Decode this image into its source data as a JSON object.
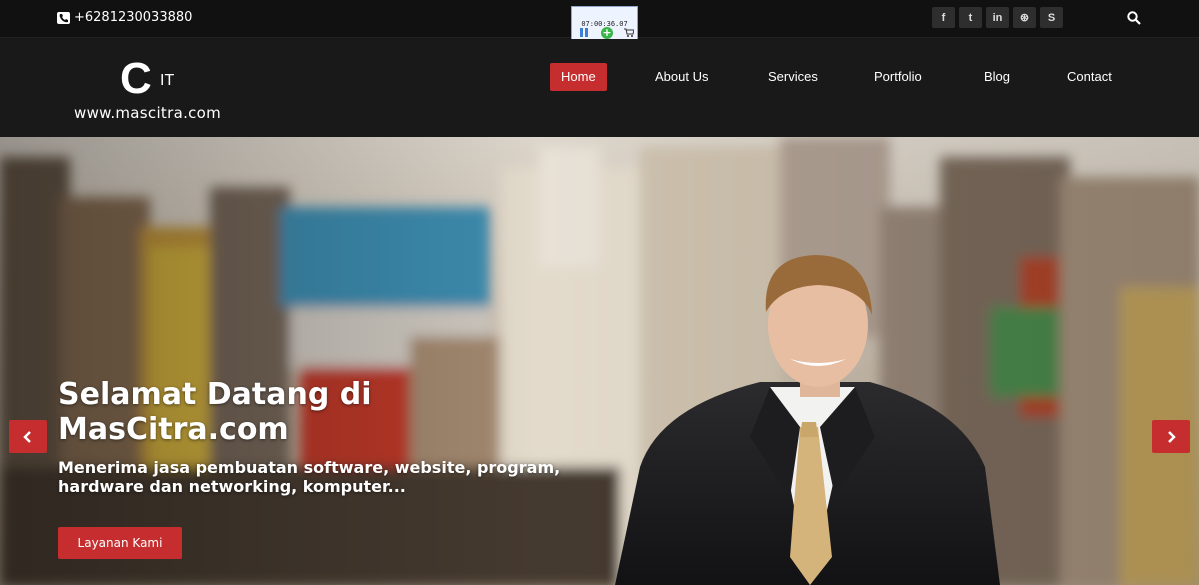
{
  "topbar": {
    "phone": "+6281230033880",
    "widget_time": "07:00:36.07",
    "social_icons": [
      {
        "name": "facebook-icon",
        "glyph": "f"
      },
      {
        "name": "twitter-icon",
        "glyph": "t"
      },
      {
        "name": "linkedin-icon",
        "glyph": "in"
      },
      {
        "name": "dribbble-icon",
        "glyph": "⊛"
      },
      {
        "name": "skype-icon",
        "glyph": "S"
      }
    ]
  },
  "logo": {
    "letter": "C",
    "suffix": "IT",
    "url": "www.mascitra.com"
  },
  "nav": {
    "items": [
      {
        "label": "Home",
        "active": true
      },
      {
        "label": "About Us",
        "active": false
      },
      {
        "label": "Services",
        "active": false
      },
      {
        "label": "Portfolio",
        "active": false
      },
      {
        "label": "Blog",
        "active": false
      },
      {
        "label": "Contact",
        "active": false
      }
    ]
  },
  "hero": {
    "title": "Selamat Datang di MasCitra.com",
    "subtitle": "Menerima jasa pembuatan software, website, program, hardware dan networking, komputer...",
    "cta": "Layanan Kami"
  },
  "colors": {
    "accent": "#c52d2f",
    "topbar_bg": "#111111",
    "navbar_bg": "#191919"
  }
}
